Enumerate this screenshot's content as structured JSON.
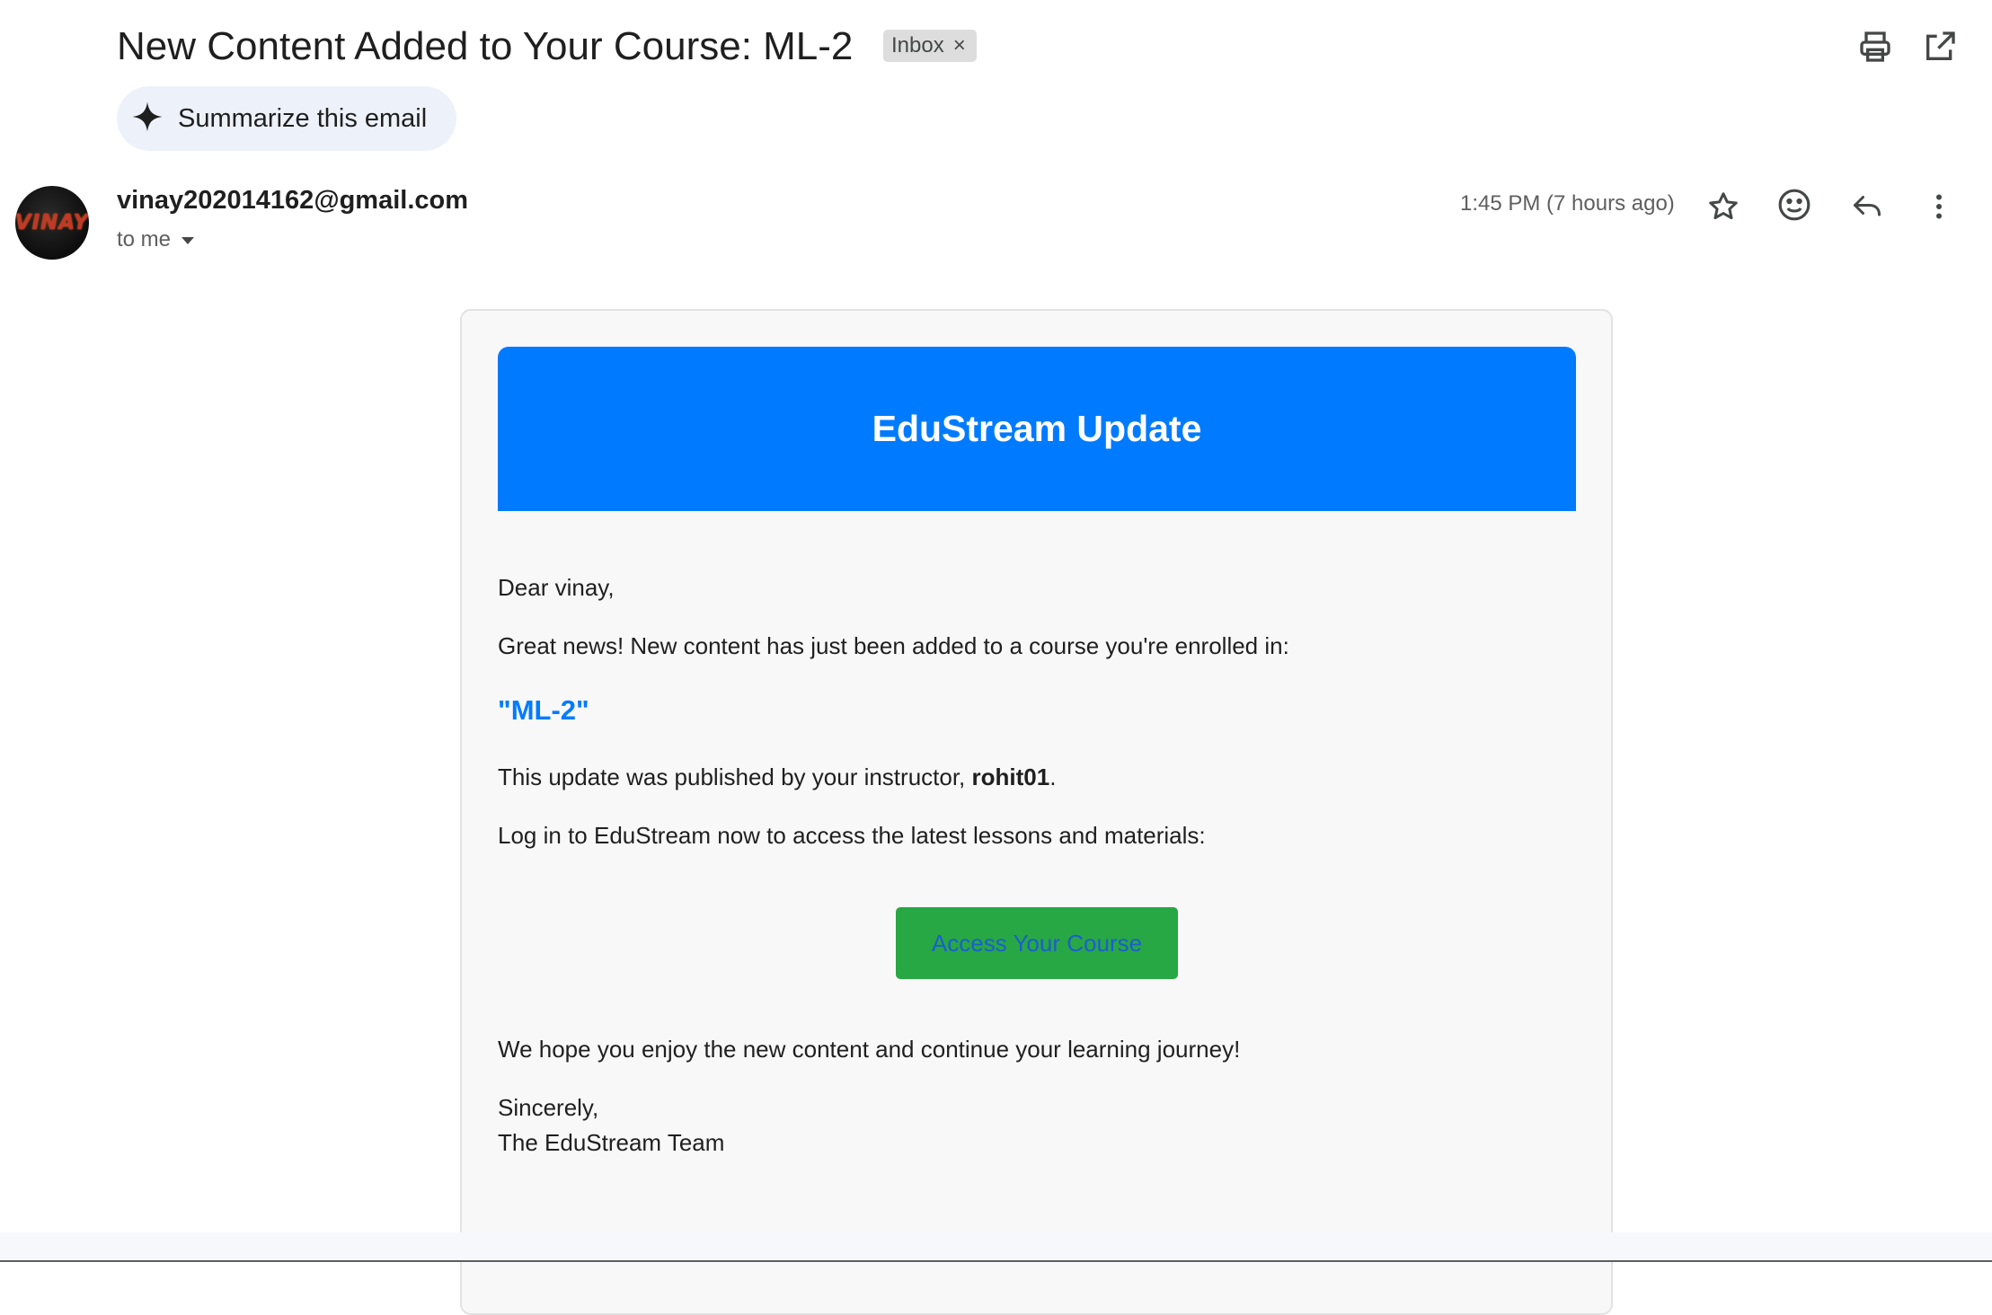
{
  "email": {
    "subject": "New Content Added to Your Course: ML-2",
    "label_chip": "Inbox",
    "label_chip_remove": "×",
    "summarize_label": "Summarize this email",
    "sender_email": "vinay202014162@gmail.com",
    "avatar_text": "VINAY",
    "recipient": "to me",
    "timestamp": "1:45 PM (7 hours ago)"
  },
  "icons": {
    "print": "print-icon",
    "popout": "open-in-new-window-icon",
    "sparkle": "sparkle-icon",
    "star": "star-icon",
    "emoji": "emoji-icon",
    "reply": "reply-icon",
    "more": "more-vertical-icon",
    "caret": "caret-down-icon"
  },
  "body": {
    "banner_title": "EduStream Update",
    "greeting": "Dear vinay,",
    "intro": "Great news! New content has just been added to a course you're enrolled in:",
    "course_name": "\"ML-2\"",
    "published_prefix": "This update was published by your instructor, ",
    "instructor": "rohit01",
    "published_suffix": ".",
    "login_prompt": "Log in to EduStream now to access the latest lessons and materials:",
    "cta_label": "Access Your Course",
    "closing": "We hope you enjoy the new content and continue your learning journey!",
    "signoff": "Sincerely,",
    "team": "The EduStream Team"
  },
  "colors": {
    "banner": "#007bff",
    "cta_background": "#28a745",
    "cta_text": "#1a5fd0",
    "course_name": "#007bff",
    "card_background": "#f8f8f8"
  }
}
